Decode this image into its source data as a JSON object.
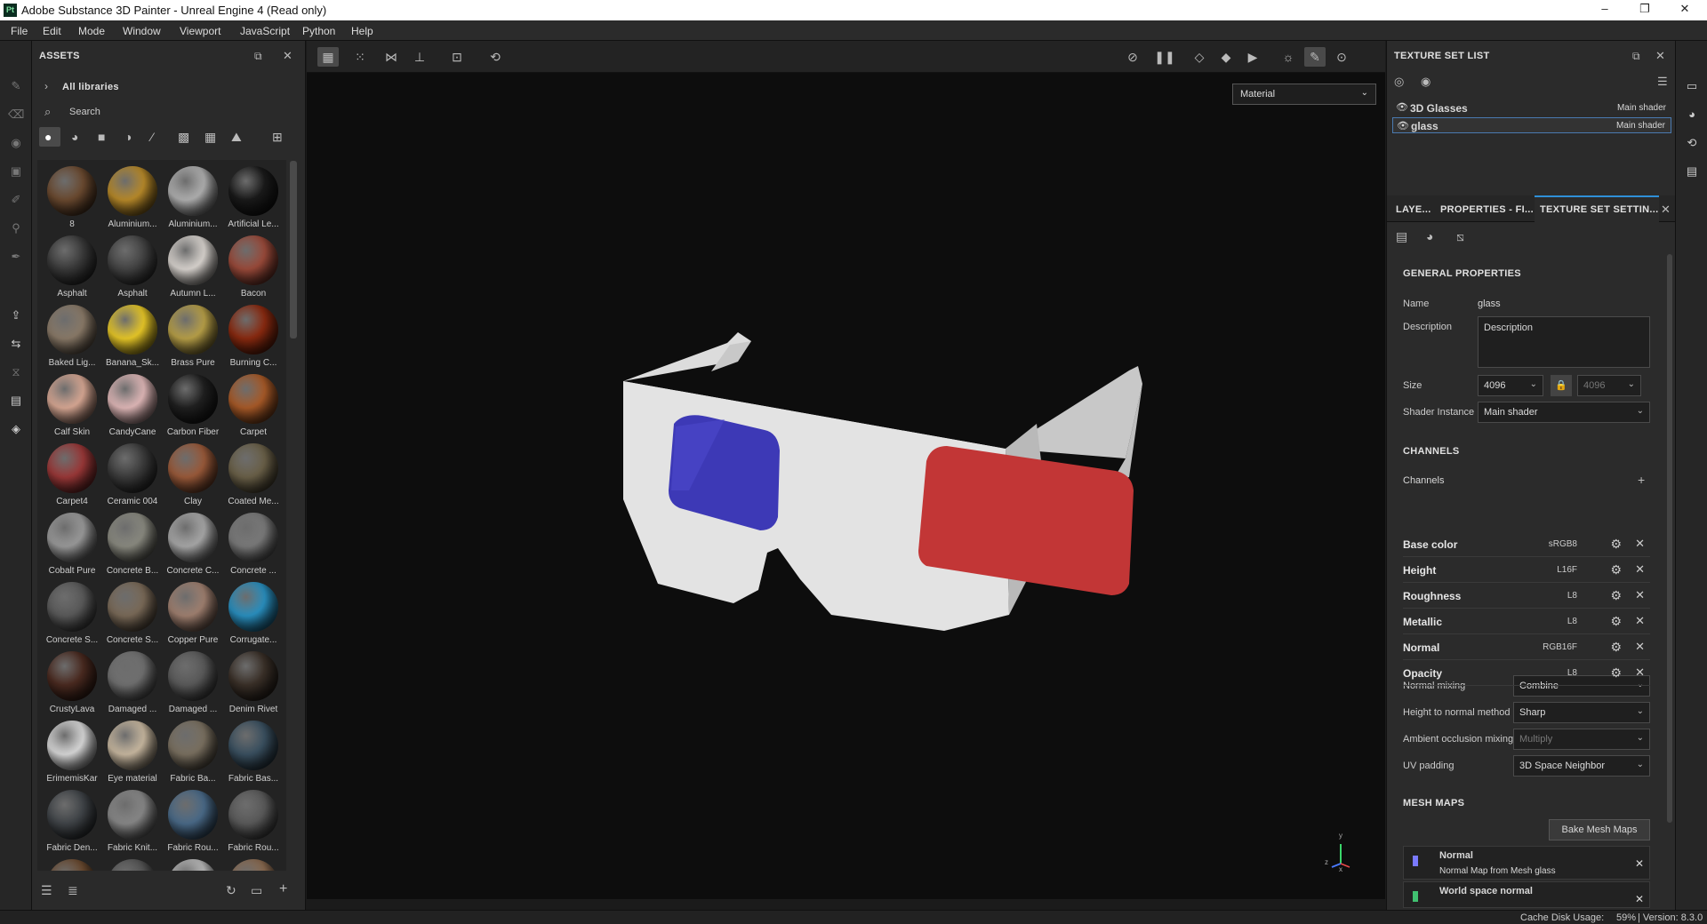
{
  "window": {
    "title": "Adobe Substance 3D Painter - Unreal Engine 4 (Read only)",
    "app_logo": "Pt",
    "minimize": "–",
    "maximize": "❐",
    "close": "✕"
  },
  "menu": [
    "File",
    "Edit",
    "Mode",
    "Window",
    "Viewport",
    "JavaScript",
    "Python",
    "Help"
  ],
  "assets": {
    "title": "ASSETS",
    "breadcrumb": "All libraries",
    "search_placeholder": "Search",
    "items": [
      {
        "label": "8",
        "color": "#6b4a30"
      },
      {
        "label": "Aluminium...",
        "color": "#b88a2a"
      },
      {
        "label": "Aluminium...",
        "color": "#b0b0b0"
      },
      {
        "label": "Artificial Le...",
        "color": "#1a1a1a"
      },
      {
        "label": "Asphalt",
        "color": "#3a3a3a"
      },
      {
        "label": "Asphalt",
        "color": "#444444"
      },
      {
        "label": "Autumn L...",
        "color": "#d9d4cf"
      },
      {
        "label": "Bacon",
        "color": "#9a4a3a"
      },
      {
        "label": "Baked Lig...",
        "color": "#8a7a68"
      },
      {
        "label": "Banana_Sk...",
        "color": "#e8c828"
      },
      {
        "label": "Brass Pure",
        "color": "#b8a048"
      },
      {
        "label": "Burning C...",
        "color": "#8a2a10"
      },
      {
        "label": "Calf Skin",
        "color": "#d8a894"
      },
      {
        "label": "CandyCane",
        "color": "#e0b8b8"
      },
      {
        "label": "Carbon Fiber",
        "color": "#202020"
      },
      {
        "label": "Carpet",
        "color": "#a85a28"
      },
      {
        "label": "Carpet4",
        "color": "#9a3838"
      },
      {
        "label": "Ceramic 004",
        "color": "#3c3c3c"
      },
      {
        "label": "Clay",
        "color": "#9a5a3a"
      },
      {
        "label": "Coated Me...",
        "color": "#6a6048"
      },
      {
        "label": "Cobalt Pure",
        "color": "#9a9a9a"
      },
      {
        "label": "Concrete B...",
        "color": "#8a8a80"
      },
      {
        "label": "Concrete C...",
        "color": "#a8a8a8"
      },
      {
        "label": "Concrete ...",
        "color": "#7a7a7a"
      },
      {
        "label": "Concrete S...",
        "color": "#5a5a5a"
      },
      {
        "label": "Concrete S...",
        "color": "#7a6a58"
      },
      {
        "label": "Copper Pure",
        "color": "#a08070"
      },
      {
        "label": "Corrugate...",
        "color": "#2a90c0"
      },
      {
        "label": "CrustyLava",
        "color": "#4a2a20"
      },
      {
        "label": "Damaged ...",
        "color": "#707070"
      },
      {
        "label": "Damaged ...",
        "color": "#5a5a5a"
      },
      {
        "label": "Denim Rivet",
        "color": "#3a3028"
      },
      {
        "label": "ErimemisKar",
        "color": "#d8d8d8"
      },
      {
        "label": "Eye material",
        "color": "#c8b8a0"
      },
      {
        "label": "Fabric Ba...",
        "color": "#7a7060"
      },
      {
        "label": "Fabric Bas...",
        "color": "#3a5060"
      },
      {
        "label": "Fabric Den...",
        "color": "#404448"
      },
      {
        "label": "Fabric Knit...",
        "color": "#888888"
      },
      {
        "label": "Fabric Rou...",
        "color": "#4a6a88"
      },
      {
        "label": "Fabric Rou...",
        "color": "#5a5a5a"
      },
      {
        "label": "",
        "color": "#6a4a30"
      },
      {
        "label": "",
        "color": "#555555"
      },
      {
        "label": "",
        "color": "#bbbbbb"
      },
      {
        "label": "",
        "color": "#8a6a50"
      }
    ]
  },
  "viewport": {
    "channel_select": "Material",
    "axis_z": "z",
    "axis_y": "y",
    "axis_x": "x"
  },
  "texture_set_list": {
    "title": "TEXTURE SET LIST",
    "items": [
      {
        "name": "3D Glasses",
        "shader": "Main shader"
      },
      {
        "name": "glass",
        "shader": "Main shader"
      }
    ]
  },
  "tabs": [
    "LAYE...",
    "PROPERTIES - FI...",
    "TEXTURE SET SETTIN..."
  ],
  "settings": {
    "general_header": "GENERAL PROPERTIES",
    "name_label": "Name",
    "name_value": "glass",
    "desc_label": "Description",
    "desc_value": "Description",
    "size_label": "Size",
    "size_value": "4096",
    "size_value2": "4096",
    "shader_label": "Shader Instance",
    "shader_value": "Main shader",
    "channels_header": "CHANNELS",
    "channels_label": "Channels",
    "channels": [
      {
        "name": "Base color",
        "format": "sRGB8"
      },
      {
        "name": "Height",
        "format": "L16F"
      },
      {
        "name": "Roughness",
        "format": "L8"
      },
      {
        "name": "Metallic",
        "format": "L8"
      },
      {
        "name": "Normal",
        "format": "RGB16F"
      },
      {
        "name": "Opacity",
        "format": "L8"
      }
    ],
    "normal_mixing_label": "Normal mixing",
    "normal_mixing_value": "Combine",
    "h2n_label": "Height to normal method",
    "h2n_value": "Sharp",
    "ao_label": "Ambient occlusion mixing",
    "ao_value": "Multiply",
    "uv_label": "UV padding",
    "uv_value": "3D Space Neighbor",
    "mesh_header": "MESH MAPS",
    "bake_button": "Bake Mesh Maps",
    "mesh_maps": [
      {
        "name": "Normal",
        "desc": "Normal Map from Mesh glass",
        "color": "#7a7aff"
      },
      {
        "name": "World space normal",
        "desc": "",
        "color": "#40c070"
      }
    ]
  },
  "status": {
    "cache": "Cache Disk Usage:",
    "cache_pct": "59%",
    "version": "| Version: 8.3.0"
  }
}
